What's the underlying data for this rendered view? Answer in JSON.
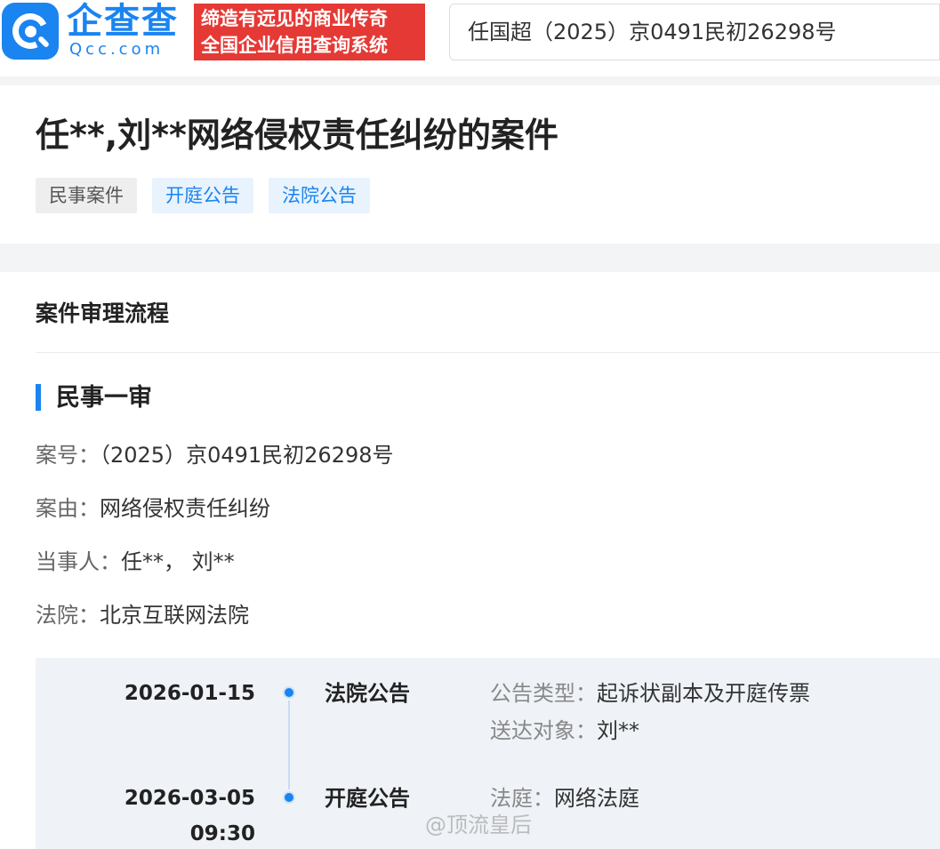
{
  "header": {
    "logo_text": "企查查",
    "logo_sub": "Qcc.com",
    "slogan_line1": "缔造有远见的商业传奇",
    "slogan_line2": "全国企业信用查询系统",
    "search_value": "任国超（2025）京0491民初26298号",
    "brand_color": "#1a84f0",
    "slogan_color": "#e53935"
  },
  "case": {
    "title": "任**,刘**网络侵权责任纠纷的案件",
    "tags": [
      "民事案件",
      "开庭公告",
      "法院公告"
    ]
  },
  "process": {
    "section_title": "案件审理流程",
    "stage_title": "民事一审",
    "fields": [
      {
        "label": "案号：",
        "value": "（2025）京0491民初26298号"
      },
      {
        "label": "案由：",
        "value": "网络侵权责任纠纷"
      },
      {
        "label": "当事人：",
        "value": "任**， 刘**"
      },
      {
        "label": "法院：",
        "value": "北京互联网法院"
      }
    ],
    "timeline": [
      {
        "date": "2026-01-15",
        "time": "",
        "type": "法院公告",
        "details": [
          {
            "label": "公告类型：",
            "value": "起诉状副本及开庭传票"
          },
          {
            "label": "送达对象：",
            "value": "刘**"
          }
        ]
      },
      {
        "date": "2026-03-05",
        "time": "09:30",
        "type": "开庭公告",
        "details": [
          {
            "label": "法庭：",
            "value": "网络法庭"
          }
        ]
      }
    ]
  },
  "watermark": "@顶流皇后"
}
